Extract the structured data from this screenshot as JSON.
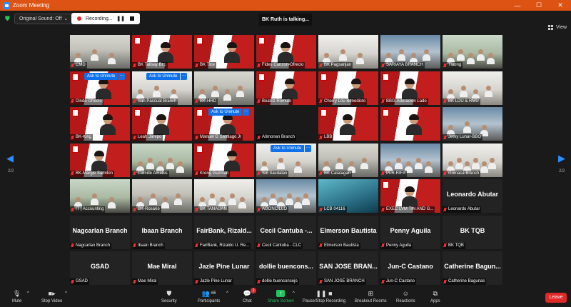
{
  "window": {
    "title": "Zoom Meeting",
    "minimize": "—",
    "maximize": "☐",
    "close": "✕"
  },
  "topbar": {
    "original_sound": "Original Sound: Off",
    "recording": "Recording...",
    "talking": "BK Ruth is talking...",
    "view": "View"
  },
  "overlay": {
    "ask_to_unmute": "Ask to Unmute",
    "more": "···"
  },
  "nav": {
    "left_page": "2/2",
    "right_page": "2/2"
  },
  "participants": [
    "CMD",
    "BK Talisay Br...",
    "BK Tlce",
    "Fides Canzon-Ofrecio",
    "BK Pagsanjan",
    "SARIAYA BRANCH",
    "Tiaong",
    "Dindo Ofrecio",
    "San Pascual Branch",
    "BK-HRD",
    "Beatriz Romulo",
    "Cherry Lou Benedicto",
    "BBG-Adoracion Lado",
    "BK LDU & RMU",
    "BK-King",
    "Leah Jarepo",
    "Manuel G Santiago Jr",
    "Atimonan Branch",
    "LBB",
    "",
    "Jerky Lunar-BBG",
    "BK-Margie Samiton",
    "Camille Amatus",
    "Kreng Guzman",
    "Sol Sacdalan",
    "BK Calatagan",
    "PLR-RIFA",
    "Gumaca Branch",
    "IT | Accounting",
    "BK-Rosario",
    "BK TANAUAN",
    "AGONCILLO",
    "LCB 04116",
    "EXEC LVM TIN AND G...",
    "Leonardo Abutar",
    "Nagcarlan Branch",
    "Ibaan Branch",
    "FairBank, Rizaldo U. Re...",
    "Cecil Cantuba - CLC",
    "Elmerson Bautista",
    "Penny Aguila",
    "BK TQB",
    "GSAD",
    "Mae Miral",
    "Jazle Pine Lunar",
    "dollie buenconsejo",
    "SAN JOSE BRANCH",
    "Jun-C Castano",
    "Catherine Bagunas"
  ],
  "text_tiles": {
    "34": "Leonardo Abutar",
    "35": "Nagcarlan Branch",
    "36": "Ibaan Branch",
    "37": "FairBank,  Rizald...",
    "38": "Cecil Cantuba  -...",
    "39": "Elmerson Bautista",
    "40": "Penny Aguila",
    "41": "BK TQB",
    "42": "GSAD",
    "43": "Mae Miral",
    "44": "Jazle Pine Lunar",
    "45": "dollie buencons...",
    "46": "SAN JOSE BRAN...",
    "47": "Jun-C Castano",
    "48": "Catherine Bagun..."
  },
  "toolbar": {
    "mute": "Mute",
    "stop_video": "Stop Video",
    "security": "Security",
    "participants": "Participants",
    "participants_count": "66",
    "chat": "Chat",
    "chat_badge": "1",
    "share_screen": "Share Screen",
    "pause_recording": "Pause/Stop Recording",
    "breakout": "Breakout Rooms",
    "reactions": "Reactions",
    "apps": "Apps",
    "leave": "Leave"
  },
  "colors": {
    "titlebar": "#dd5314",
    "accent": "#0e71eb",
    "share": "#22c55e",
    "leave": "#e02828"
  }
}
